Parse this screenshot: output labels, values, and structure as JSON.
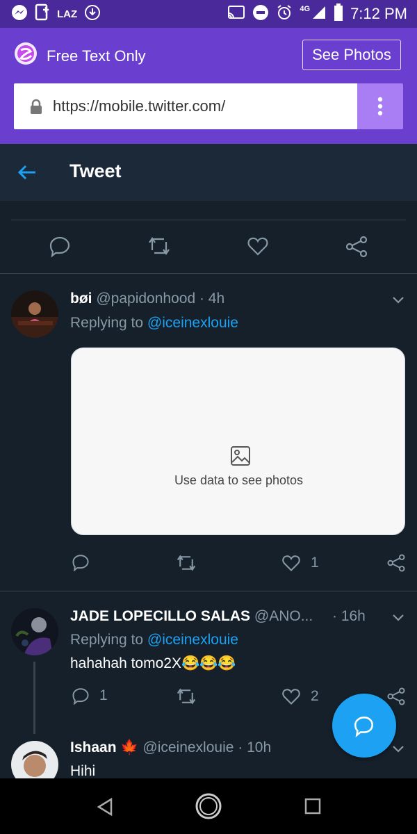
{
  "status_bar": {
    "carrier_text": "LAZ",
    "network": "4G",
    "time": "7:12 PM"
  },
  "browser": {
    "app_title": "Free Text Only",
    "see_photos_label": "See Photos",
    "url": "https://mobile.twitter.com/"
  },
  "header": {
    "title": "Tweet"
  },
  "tweets": [
    {
      "name": "bøi",
      "handle": "@papidonhood",
      "time": "· 4h",
      "replying_prefix": "Replying to ",
      "replying_to": "@iceinexlouie",
      "photo_placeholder": "Use data to see photos",
      "like_count": "1"
    },
    {
      "name": "JADE LOPECILLO SALAS",
      "handle": "@ANO...",
      "time": "· 16h",
      "replying_prefix": "Replying to ",
      "replying_to": "@iceinexlouie",
      "text": "hahahah tomo2X😂😂😂",
      "reply_count": "1",
      "like_count": "2"
    },
    {
      "name": "Ishaan",
      "flag": "🍁",
      "handle": "@iceinexlouie",
      "time": "· 10h",
      "text": "Hihi"
    }
  ],
  "colors": {
    "status_bar": "#4a2a9a",
    "browser_bar": "#6a3ecf",
    "menu_button": "#a97ef5",
    "background": "#15202b",
    "link": "#1da1f2",
    "muted": "#8899a6"
  }
}
